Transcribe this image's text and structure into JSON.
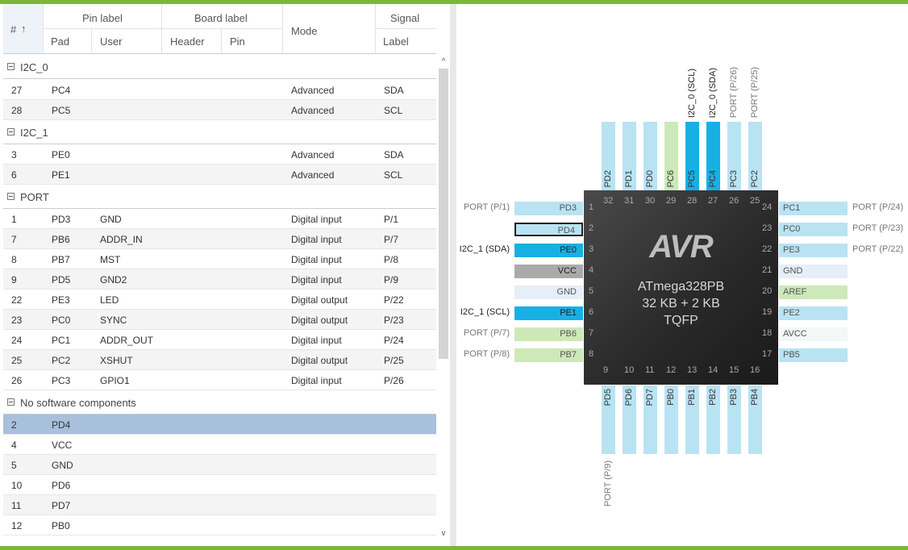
{
  "header": {
    "hash": "#",
    "sort_arrow": "↑",
    "pin_label": "Pin label",
    "pad": "Pad",
    "user": "User",
    "board_label": "Board label",
    "header_col": "Header",
    "pin": "Pin",
    "mode": "Mode",
    "signal": "Signal",
    "label": "Label"
  },
  "groups": {
    "i2c0": "I2C_0",
    "i2c1": "I2C_1",
    "port": "PORT",
    "nosw": "No software components"
  },
  "rows": {
    "r1": {
      "num": "27",
      "pad": "PC4",
      "user": "",
      "mode": "Advanced",
      "label": "SDA"
    },
    "r2": {
      "num": "28",
      "pad": "PC5",
      "user": "",
      "mode": "Advanced",
      "label": "SCL"
    },
    "r3": {
      "num": "3",
      "pad": "PE0",
      "user": "",
      "mode": "Advanced",
      "label": "SDA"
    },
    "r4": {
      "num": "6",
      "pad": "PE1",
      "user": "",
      "mode": "Advanced",
      "label": "SCL"
    },
    "r5": {
      "num": "1",
      "pad": "PD3",
      "user": "GND",
      "mode": "Digital input",
      "label": "P/1"
    },
    "r6": {
      "num": "7",
      "pad": "PB6",
      "user": "ADDR_IN",
      "mode": "Digital input",
      "label": "P/7"
    },
    "r7": {
      "num": "8",
      "pad": "PB7",
      "user": "MST",
      "mode": "Digital input",
      "label": "P/8"
    },
    "r8": {
      "num": "9",
      "pad": "PD5",
      "user": "GND2",
      "mode": "Digital input",
      "label": "P/9"
    },
    "r9": {
      "num": "22",
      "pad": "PE3",
      "user": "LED",
      "mode": "Digital output",
      "label": "P/22"
    },
    "r10": {
      "num": "23",
      "pad": "PC0",
      "user": "SYNC",
      "mode": "Digital output",
      "label": "P/23"
    },
    "r11": {
      "num": "24",
      "pad": "PC1",
      "user": "ADDR_OUT",
      "mode": "Digital input",
      "label": "P/24"
    },
    "r12": {
      "num": "25",
      "pad": "PC2",
      "user": "XSHUT",
      "mode": "Digital output",
      "label": "P/25"
    },
    "r13": {
      "num": "26",
      "pad": "PC3",
      "user": "GPIO1",
      "mode": "Digital input",
      "label": "P/26"
    },
    "r14": {
      "num": "2",
      "pad": "PD4"
    },
    "r15": {
      "num": "4",
      "pad": "VCC"
    },
    "r16": {
      "num": "5",
      "pad": "GND"
    },
    "r17": {
      "num": "10",
      "pad": "PD6"
    },
    "r18": {
      "num": "11",
      "pad": "PD7"
    },
    "r19": {
      "num": "12",
      "pad": "PB0"
    }
  },
  "chip": {
    "logo": "AVR",
    "name": "ATmega328PB",
    "memory": "32 KB + 2 KB",
    "package": "TQFP"
  },
  "pins": {
    "p1": {
      "n": "1",
      "pad": "PD3",
      "ext": "PORT (P/1)",
      "color": "#b9e3f3"
    },
    "p2": {
      "n": "2",
      "pad": "PD4",
      "ext": "",
      "color": "#b9e3f3"
    },
    "p3": {
      "n": "3",
      "pad": "PE0",
      "ext": "I2C_1 (SDA)",
      "color": "#18b0e3"
    },
    "p4": {
      "n": "4",
      "pad": "VCC",
      "ext": "",
      "color": "#aaaaaa"
    },
    "p5": {
      "n": "5",
      "pad": "GND",
      "ext": "",
      "color": "#e6eef8"
    },
    "p6": {
      "n": "6",
      "pad": "PE1",
      "ext": "I2C_1 (SCL)",
      "color": "#18b0e3"
    },
    "p7": {
      "n": "7",
      "pad": "PB6",
      "ext": "PORT (P/7)",
      "color": "#cde8b9"
    },
    "p8": {
      "n": "8",
      "pad": "PB7",
      "ext": "PORT (P/8)",
      "color": "#cde8b9"
    },
    "p9": {
      "n": "9",
      "pad": "PD5",
      "ext": "PORT (P/9)",
      "color": "#b9e3f3"
    },
    "p10": {
      "n": "10",
      "pad": "PD6",
      "color": "#b9e3f3"
    },
    "p11": {
      "n": "11",
      "pad": "PD7",
      "color": "#b9e3f3"
    },
    "p12": {
      "n": "12",
      "pad": "PB0",
      "color": "#b9e3f3"
    },
    "p13": {
      "n": "13",
      "pad": "PB1",
      "color": "#b9e3f3"
    },
    "p14": {
      "n": "14",
      "pad": "PB2",
      "color": "#b9e3f3"
    },
    "p15": {
      "n": "15",
      "pad": "PB3",
      "color": "#b9e3f3"
    },
    "p16": {
      "n": "16",
      "pad": "PB4",
      "color": "#b9e3f3"
    },
    "p17": {
      "n": "17",
      "pad": "PB5",
      "ext": "",
      "color": "#b9e3f3"
    },
    "p18": {
      "n": "18",
      "pad": "AVCC",
      "ext": "",
      "color": "#f2f8f4"
    },
    "p19": {
      "n": "19",
      "pad": "PE2",
      "ext": "",
      "color": "#b9e3f3"
    },
    "p20": {
      "n": "20",
      "pad": "AREF",
      "ext": "",
      "color": "#cde8b9"
    },
    "p21": {
      "n": "21",
      "pad": "GND",
      "ext": "",
      "color": "#e6eef8"
    },
    "p22": {
      "n": "22",
      "pad": "PE3",
      "ext": "PORT (P/22)",
      "color": "#b9e3f3"
    },
    "p23": {
      "n": "23",
      "pad": "PC0",
      "ext": "PORT (P/23)",
      "color": "#b9e3f3"
    },
    "p24": {
      "n": "24",
      "pad": "PC1",
      "ext": "PORT (P/24)",
      "color": "#b9e3f3"
    },
    "p25": {
      "n": "25",
      "pad": "PC2",
      "ext": "PORT (P/25)",
      "color": "#b9e3f3"
    },
    "p26": {
      "n": "26",
      "pad": "PC3",
      "ext": "PORT (P/26)",
      "color": "#b9e3f3"
    },
    "p27": {
      "n": "27",
      "pad": "PC4",
      "ext": "I2C_0 (SDA)",
      "color": "#18b0e3"
    },
    "p28": {
      "n": "28",
      "pad": "PC5",
      "ext": "I2C_0 (SCL)",
      "color": "#18b0e3"
    },
    "p29": {
      "n": "29",
      "pad": "PC6",
      "ext": "",
      "color": "#cde8b9"
    },
    "p30": {
      "n": "30",
      "pad": "PD0",
      "ext": "",
      "color": "#b9e3f3"
    },
    "p31": {
      "n": "31",
      "pad": "PD1",
      "ext": "",
      "color": "#b9e3f3"
    },
    "p32": {
      "n": "32",
      "pad": "PD2",
      "ext": "",
      "color": "#b9e3f3"
    }
  },
  "scroll": {
    "up": "^",
    "down": "v"
  }
}
